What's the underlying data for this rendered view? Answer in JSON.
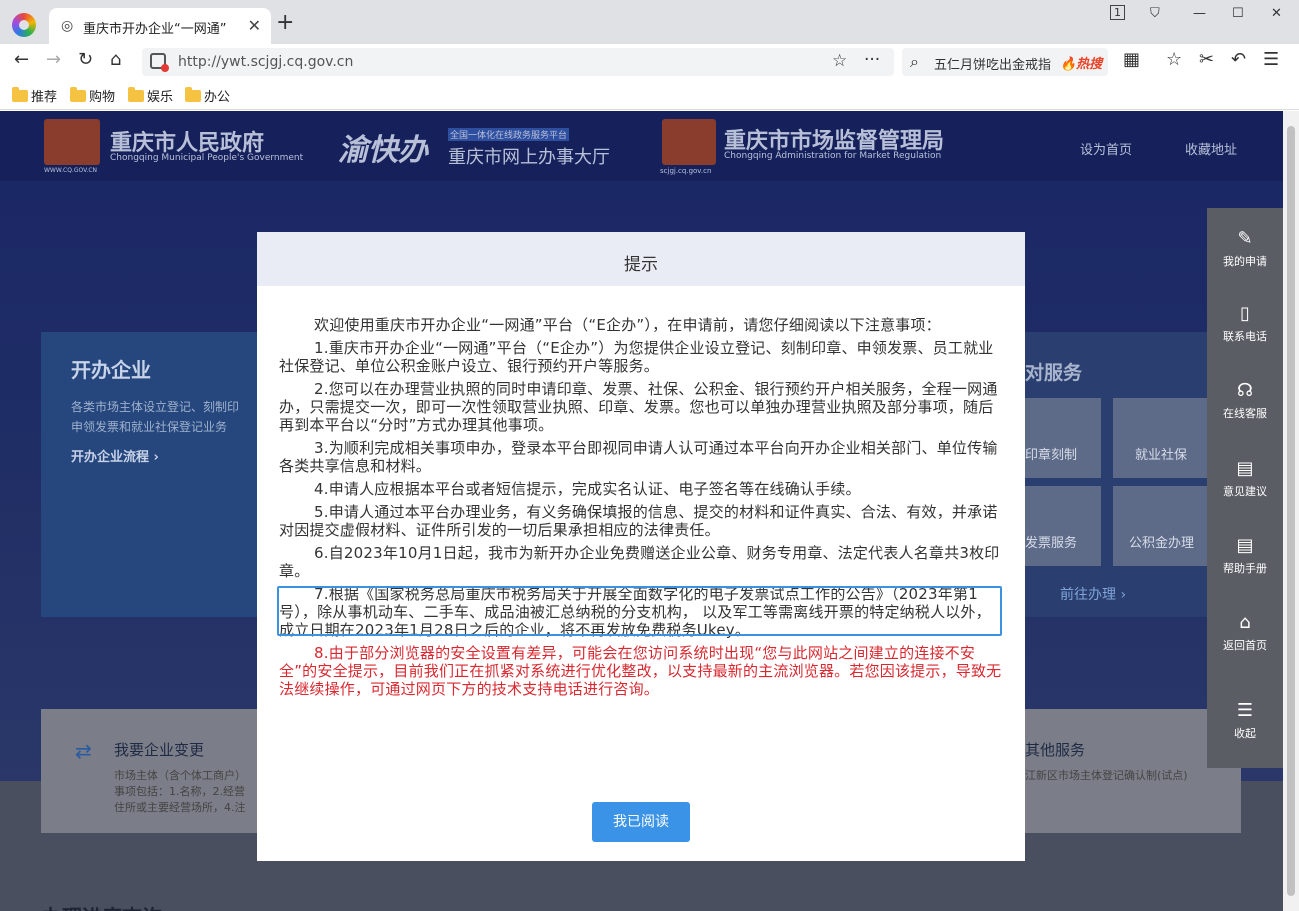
{
  "browser": {
    "tab_title": "重庆市开办企业“一网通”",
    "url": "http://ywt.scjgj.cq.gov.cn",
    "search_query": "五仁月饼吃出金戒指",
    "search_hot": "🔥热搜",
    "tab_count": "1"
  },
  "bookmarks": [
    "推荐",
    "购物",
    "娱乐",
    "办公"
  ],
  "header": {
    "gov_name": "重庆市人民政府",
    "gov_en": "Chongqing Municipal People's Government",
    "gov_url": "WWW.CQ.GOV.CN",
    "ykb_logo": "渝快办",
    "ykb_tag": "全国一体化在线政务服务平台",
    "ykb_name": "重庆市网上办事大厅",
    "smr_name": "重庆市市场监督管理局",
    "smr_en": "Chongqing  Administration for Market Regulation",
    "smr_url": "scjgj.cq.gov.cn",
    "set_home": "设为首页",
    "favorite": "收藏地址"
  },
  "bg": {
    "left_title": "开办企业",
    "left_desc1": "各类市场主体设立登记、刻制印",
    "left_desc2": "申领发票和就业社保登记业务",
    "left_link": "开办企业流程 ›",
    "right_title": "对服务",
    "svc1": "印章刻制",
    "svc2": "就业社保",
    "svc3": "发票服务",
    "svc4": "公积金办理",
    "goto": "前往办理  ›",
    "change_title": "我要企业变更",
    "change_desc1": "市场主体（含个体工商户）",
    "change_desc2": "事项包括：1.名称，2.经营",
    "change_desc3": "住所或主要经营场所，4.注",
    "other_title": "其他服务",
    "other_desc": "江新区市场主体登记确认制(试点)",
    "progress": "办理进度查询"
  },
  "sidebar": [
    {
      "icon": "✎",
      "label": "我的申请"
    },
    {
      "icon": "▯",
      "label": "联系电话"
    },
    {
      "icon": "☊",
      "label": "在线客服"
    },
    {
      "icon": "▤",
      "label": "意见建议"
    },
    {
      "icon": "▤",
      "label": "帮助手册"
    },
    {
      "icon": "⌂",
      "label": "返回首页"
    },
    {
      "icon": "☰",
      "label": "收起"
    }
  ],
  "modal": {
    "title": "提示",
    "p0": "欢迎使用重庆市开办企业“一网通”平台（“E企办”），在申请前，请您仔细阅读以下注意事项：",
    "p1": "1.重庆市开办企业“一网通”平台（“E企办”）为您提供企业设立登记、刻制印章、申领发票、员工就业社保登记、单位公积金账户设立、银行预约开户等服务。",
    "p2": "2.您可以在办理营业执照的同时申请印章、发票、社保、公积金、银行预约开户相关服务，全程一网通办，只需提交一次，即可一次性领取营业执照、印章、发票。您也可以单独办理营业执照及部分事项，随后再到本平台以“分时”方式办理其他事项。",
    "p3": "3.为顺利完成相关事项申办，登录本平台即视同申请人认可通过本平台向开办企业相关部门、单位传输各类共享信息和材料。",
    "p4": "4.申请人应根据本平台或者短信提示，完成实名认证、电子签名等在线确认手续。",
    "p5": "5.申请人通过本平台办理业务，有义务确保填报的信息、提交的材料和证件真实、合法、有效，并承诺对因提交虚假材料、证件所引发的一切后果承担相应的法律责任。",
    "p6": "6.自2023年10月1日起，我市为新开办企业免费赠送企业公章、财务专用章、法定代表人名章共3枚印章。",
    "p7": "7.根据《国家税务总局重庆市税务局关于开展全面数字化的电子发票试点工作的公告》（2023年第1号），除从事机动车、二手车、成品油被汇总纳税的分支机构， 以及军工等需离线开票的特定纳税人以外，成立日期在2023年1月28日之后的企业，将不再发放免费税务Ukey。",
    "p8": "8.由于部分浏览器的安全设置有差异，可能会在您访问系统时出现“您与此网站之间建立的连接不安全”的安全提示，目前我们正在抓紧对系统进行优化整改，以支持最新的主流浏览器。若您因该提示，导致无法继续操作，可通过网页下方的技术支持电话进行咨询。",
    "confirm": "我已阅读"
  }
}
